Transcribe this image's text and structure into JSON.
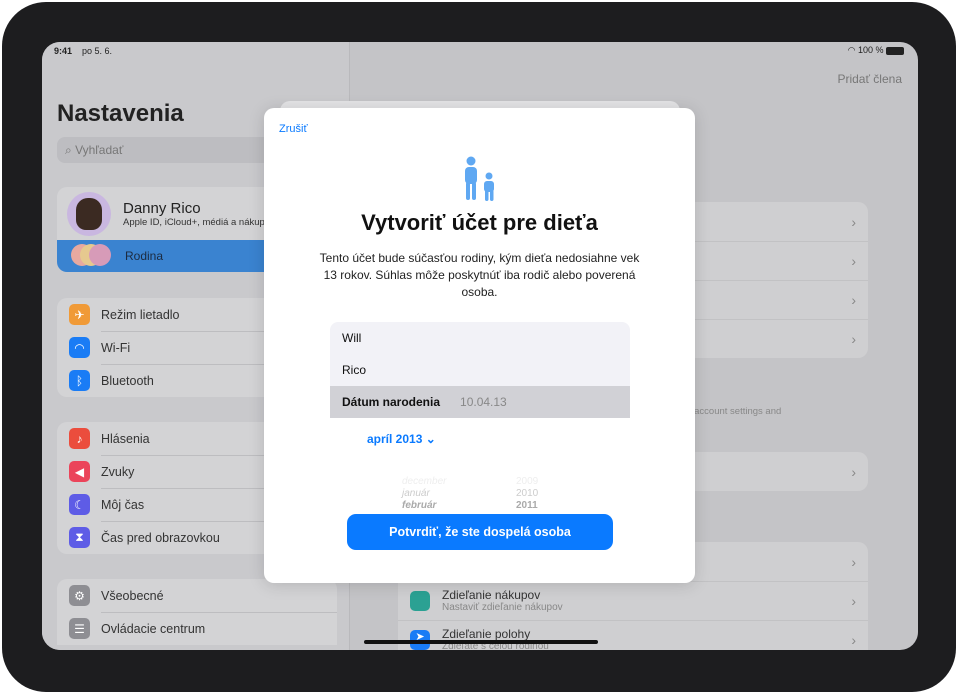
{
  "status": {
    "time": "9:41",
    "date": "po 5. 6.",
    "battery": "100 %"
  },
  "sidebar": {
    "title": "Nastavenia",
    "search_placeholder": "Vyhľadať",
    "profile": {
      "name": "Danny Rico",
      "subtitle": "Apple ID, iCloud+, médiá a nákupy"
    },
    "family": "Rodina",
    "group1": [
      {
        "label": "Režim lietadlo",
        "icon": "airplane-icon",
        "color": "#f09a37"
      },
      {
        "label": "Wi-Fi",
        "icon": "wifi-icon",
        "color": "#1a7cf5"
      },
      {
        "label": "Bluetooth",
        "icon": "bluetooth-icon",
        "color": "#1a7cf5"
      }
    ],
    "group2": [
      {
        "label": "Hlásenia",
        "icon": "bell-icon",
        "color": "#eb4d3d"
      },
      {
        "label": "Zvuky",
        "icon": "speaker-icon",
        "color": "#eb445a"
      },
      {
        "label": "Môj čas",
        "icon": "moon-icon",
        "color": "#5e5ce6"
      },
      {
        "label": "Čas pred obrazovkou",
        "icon": "hourglass-icon",
        "color": "#5e5ce6"
      }
    ],
    "group3": [
      {
        "label": "Všeobecné",
        "icon": "gear-icon",
        "color": "#8e8e93"
      },
      {
        "label": "Ovládacie centrum",
        "icon": "toggles-icon",
        "color": "#8e8e93"
      }
    ]
  },
  "detail": {
    "add_member": "Pridať člena",
    "footer_note": "ild account settings and",
    "purchase_sharing": {
      "title": "Zdieľanie nákupov",
      "subtitle": "Nastaviť zdieľanie nákupov"
    },
    "location_sharing": {
      "title": "Zdieľanie polohy",
      "subtitle": "Zdieľate s celou rodinou"
    }
  },
  "modal": {
    "cancel": "Zrušiť",
    "icon": "parent-child-icon",
    "title": "Vytvoriť účet pre dieťa",
    "description": "Tento účet bude súčasťou rodiny, kým dieťa nedosiahne vek 13 rokov. Súhlas môže poskytnúť iba rodič alebo poverená osoba.",
    "first_name": "Will",
    "last_name": "Rico",
    "birthdate_label": "Dátum narodenia",
    "birthdate_value": "10.04.13",
    "month_year": "apríl 2013",
    "picker": {
      "months": [
        "december",
        "január",
        "február"
      ],
      "years": [
        "2009",
        "2010",
        "2011"
      ]
    },
    "confirm": "Potvrdiť, že ste dospelá osoba"
  },
  "colors": {
    "accent": "#0a7aff",
    "selected": "#3a83d0"
  }
}
